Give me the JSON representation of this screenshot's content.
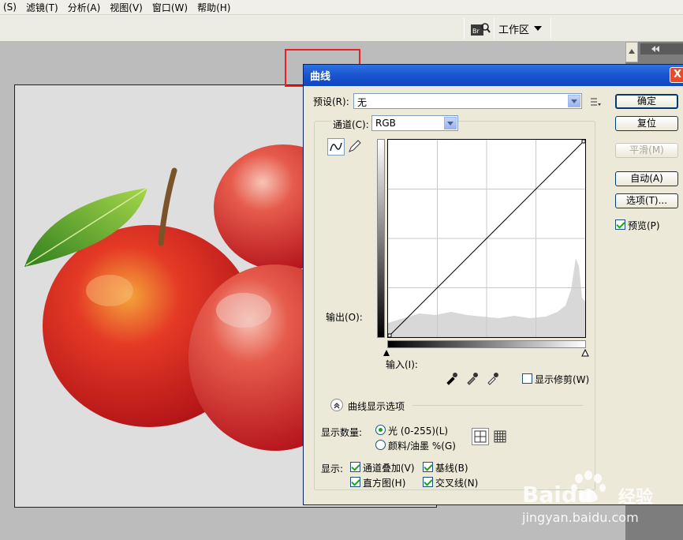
{
  "menu": {
    "items": [
      "(S)",
      "滤镜(T)",
      "分析(A)",
      "视图(V)",
      "窗口(W)",
      "帮助(H)"
    ]
  },
  "toolbar": {
    "bridge_label": "Br",
    "workspace_label": "工作区"
  },
  "dialog": {
    "title": "曲线",
    "close_label": "X",
    "preset_label": "预设(R):",
    "preset_value": "无",
    "channel_label": "通道(C):",
    "channel_value": "RGB",
    "output_label": "输出(O):",
    "input_label": "输入(I):",
    "show_clipping_label": "显示修剪(W)",
    "curve_options_label": "曲线显示选项",
    "show_amount_label": "显示数量:",
    "light_label": "光 (0-255)(L)",
    "pigment_label": "颜料/油墨 %(G)",
    "show_label": "显示:",
    "channel_overlay_label": "通道叠加(V)",
    "baseline_label": "基线(B)",
    "histogram_label": "直方图(H)",
    "intersection_label": "交叉线(N)",
    "buttons": {
      "ok": "确定",
      "reset": "复位",
      "smooth": "平滑(M)",
      "auto": "自动(A)",
      "options": "选项(T)..."
    },
    "preview_label": "预览(P)",
    "preview_checked": true
  },
  "watermark": {
    "brand": "Baidu",
    "brand_cn": "经验",
    "url": "jingyan.baidu.com"
  },
  "colors": {
    "title_blue": "#1b57d0",
    "highlight_red": "#e8221e",
    "check_green": "#21a121"
  }
}
